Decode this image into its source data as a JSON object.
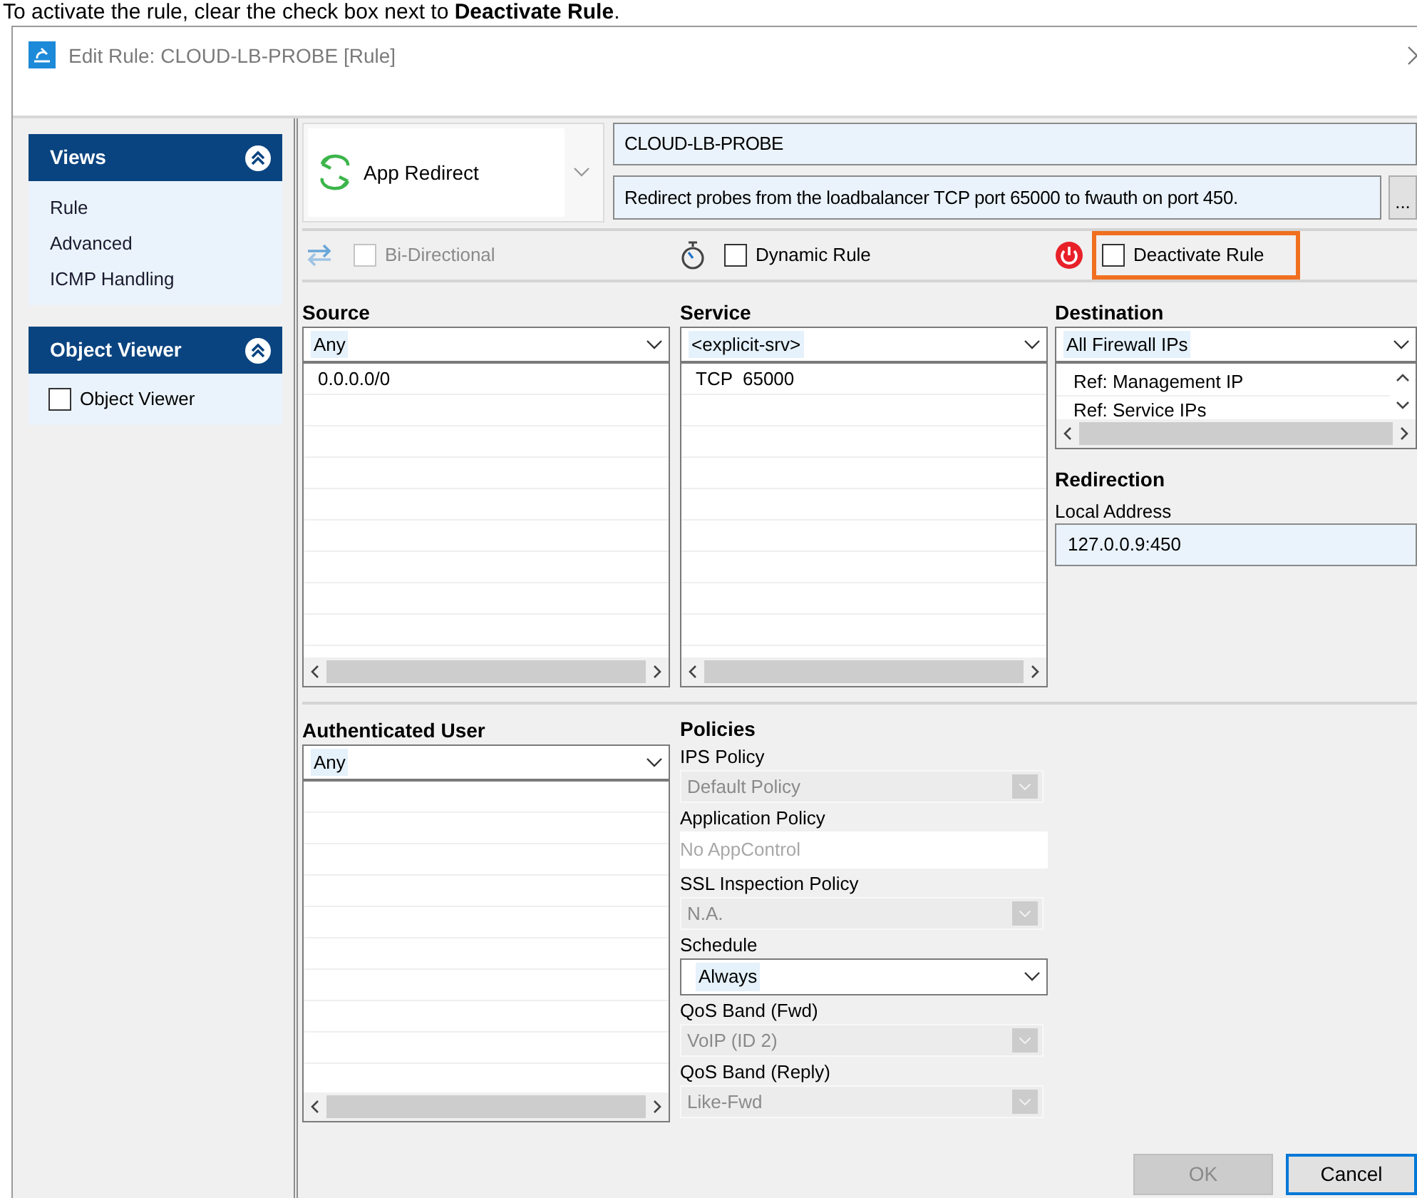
{
  "caption": "To activate the rule, clear the check box next to **Deactivate Rule**.",
  "window": {
    "title": "Edit Rule: CLOUD-LB-PROBE [Rule]"
  },
  "sidebar": {
    "panels": [
      {
        "title": "Views",
        "expanded": true,
        "items": [
          {
            "label": "Rule",
            "kind": "link"
          },
          {
            "label": "Advanced",
            "kind": "link"
          },
          {
            "label": "ICMP Handling",
            "kind": "link"
          }
        ]
      },
      {
        "title": "Object Viewer",
        "expanded": true,
        "items": [
          {
            "label": "Object Viewer",
            "kind": "checkbox",
            "checked": false
          }
        ]
      }
    ]
  },
  "rule": {
    "action": "App Redirect",
    "name": "CLOUD-LB-PROBE",
    "description": "Redirect probes from the loadbalancer TCP port 65000 to fwauth on port 450.",
    "more_button": "..."
  },
  "options": [
    {
      "kind": "bidirectional",
      "label": "Bi-Directional",
      "checked": false,
      "disabled": true,
      "highlighted": false
    },
    {
      "kind": "timer",
      "label": "Dynamic Rule",
      "checked": false,
      "disabled": false,
      "highlighted": false
    },
    {
      "kind": "power",
      "label": "Deactivate Rule",
      "checked": false,
      "disabled": false,
      "highlighted": true
    }
  ],
  "source": {
    "heading": "Source",
    "selection": "Any",
    "entries": [
      "0.0.0.0/0"
    ]
  },
  "service": {
    "heading": "Service",
    "selection": "<explicit-srv>",
    "entries": [
      "TCP  65000"
    ]
  },
  "destination": {
    "heading": "Destination",
    "selection": "All Firewall IPs",
    "entries": [
      "Ref: Management IP",
      "Ref: Service IPs"
    ]
  },
  "redirection": {
    "heading": "Redirection",
    "label": "Local Address",
    "value": "127.0.0.9:450"
  },
  "authenticated_user": {
    "heading": "Authenticated User",
    "selection": "Any"
  },
  "policies": {
    "heading": "Policies",
    "fields": [
      {
        "label": "IPS Policy",
        "value": "Default Policy",
        "kind": "dropdown",
        "disabled": true
      },
      {
        "label": "Application Policy",
        "value": "No AppControl",
        "kind": "text",
        "disabled": true
      },
      {
        "label": "SSL Inspection Policy",
        "value": "N.A.",
        "kind": "dropdown",
        "disabled": true
      },
      {
        "label": "Schedule",
        "value": "Always",
        "kind": "dropdown",
        "disabled": false
      },
      {
        "label": "QoS Band (Fwd)",
        "value": "VoIP (ID 2)",
        "kind": "dropdown",
        "disabled": true
      },
      {
        "label": "QoS Band (Reply)",
        "value": "Like-Fwd",
        "kind": "dropdown",
        "disabled": true
      }
    ]
  },
  "buttons": [
    {
      "label": "OK",
      "disabled": true,
      "focused": false
    },
    {
      "label": "Cancel",
      "disabled": false,
      "focused": true
    }
  ]
}
